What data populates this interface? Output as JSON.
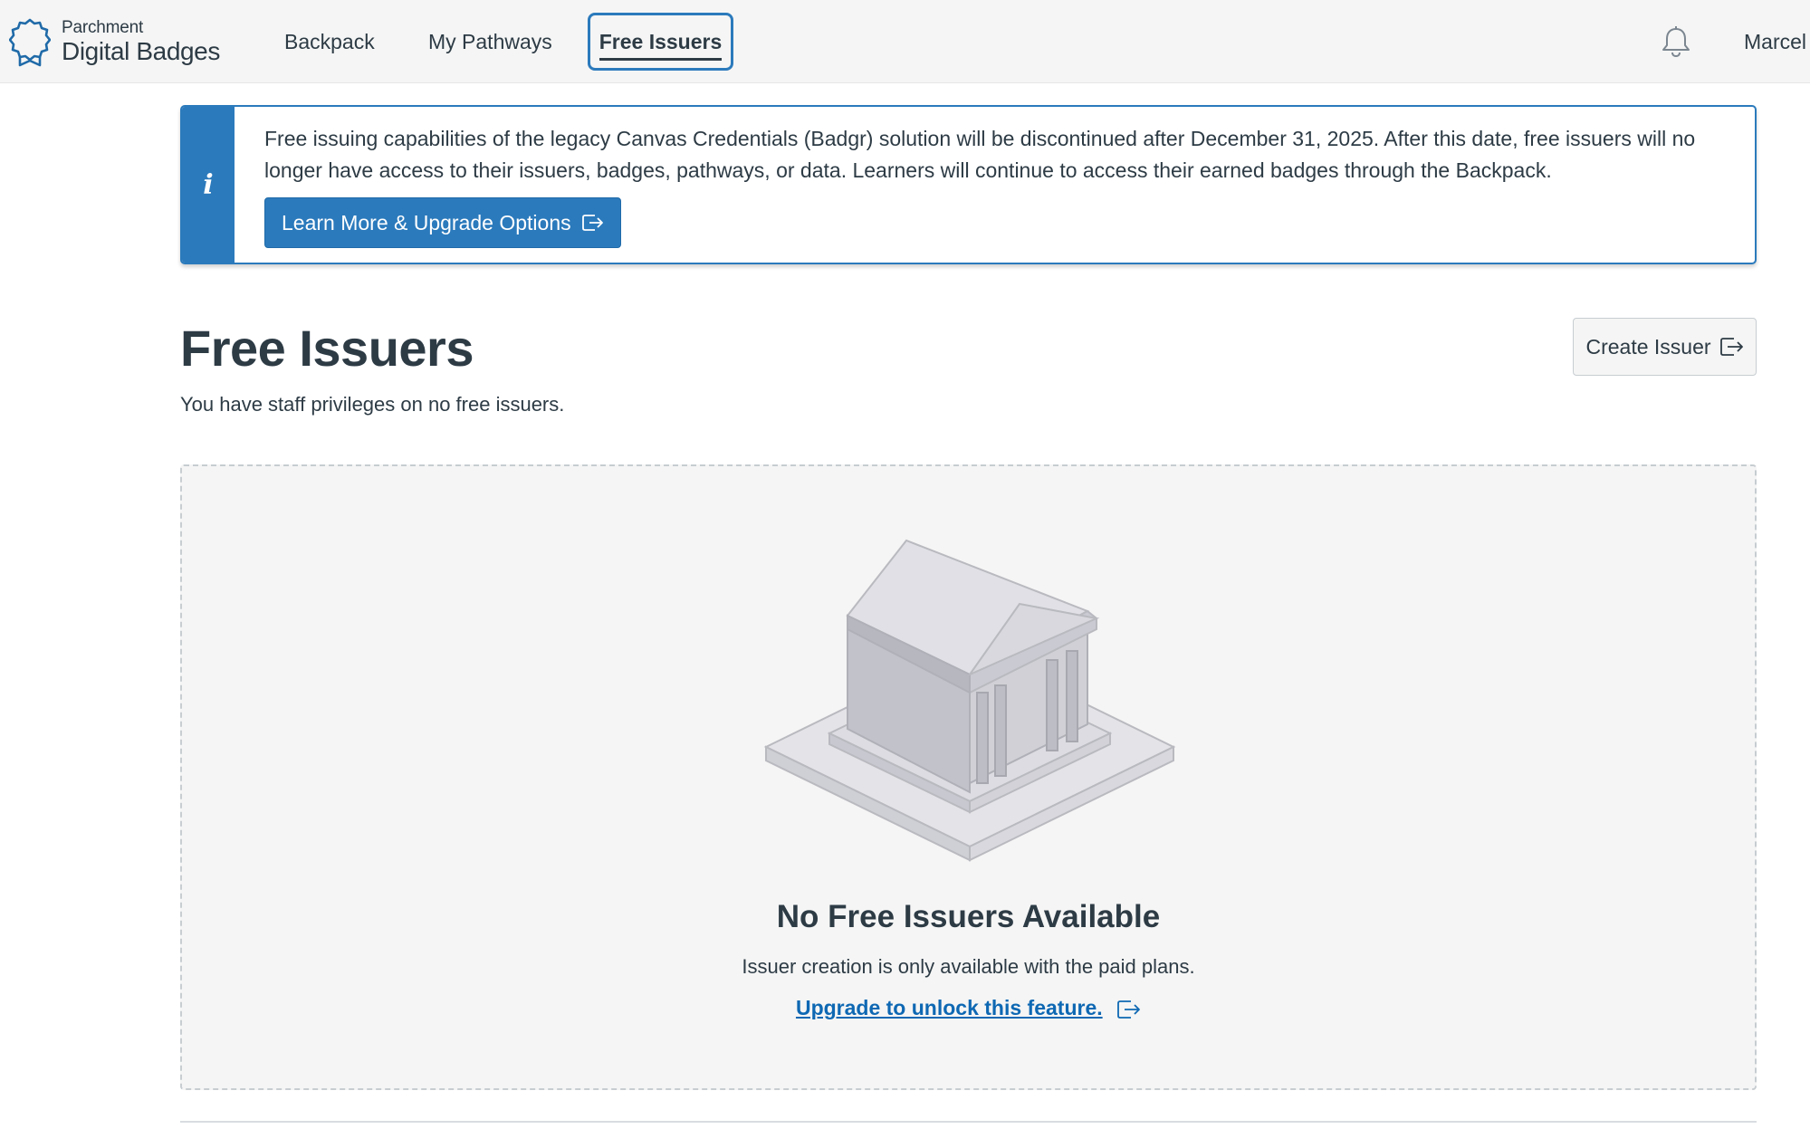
{
  "header": {
    "brand_small": "Parchment",
    "brand_big": "Digital Badges",
    "nav": [
      {
        "label": "Backpack",
        "active": false
      },
      {
        "label": "My Pathways",
        "active": false
      },
      {
        "label": "Free Issuers",
        "active": true
      }
    ],
    "notification_icon": "bell-icon",
    "user_name": "Marcel"
  },
  "banner": {
    "icon": "info-icon",
    "icon_glyph": "i",
    "message": "Free issuing capabilities of the legacy Canvas Credentials (Badgr) solution will be discontinued after December 31, 2025. After this date, free issuers will no longer have access to their issuers, badges, pathways, or data. Learners will continue to access their earned badges through the Backpack.",
    "button_label": "Learn More & Upgrade Options",
    "button_icon": "external-link-icon"
  },
  "page": {
    "title": "Free Issuers",
    "subtitle": "You have staff privileges on no free issuers.",
    "create_button_label": "Create Issuer",
    "create_button_icon": "external-link-icon"
  },
  "empty_state": {
    "illustration": "institution-building-icon",
    "title": "No Free Issuers Available",
    "description": "Issuer creation is only available with the paid plans.",
    "link_label": "Upgrade to unlock this feature.",
    "link_icon": "external-link-icon"
  },
  "colors": {
    "accent": "#2b7abc",
    "link": "#0e68b3",
    "text": "#2d3b45",
    "header_bg": "#f5f5f5"
  }
}
